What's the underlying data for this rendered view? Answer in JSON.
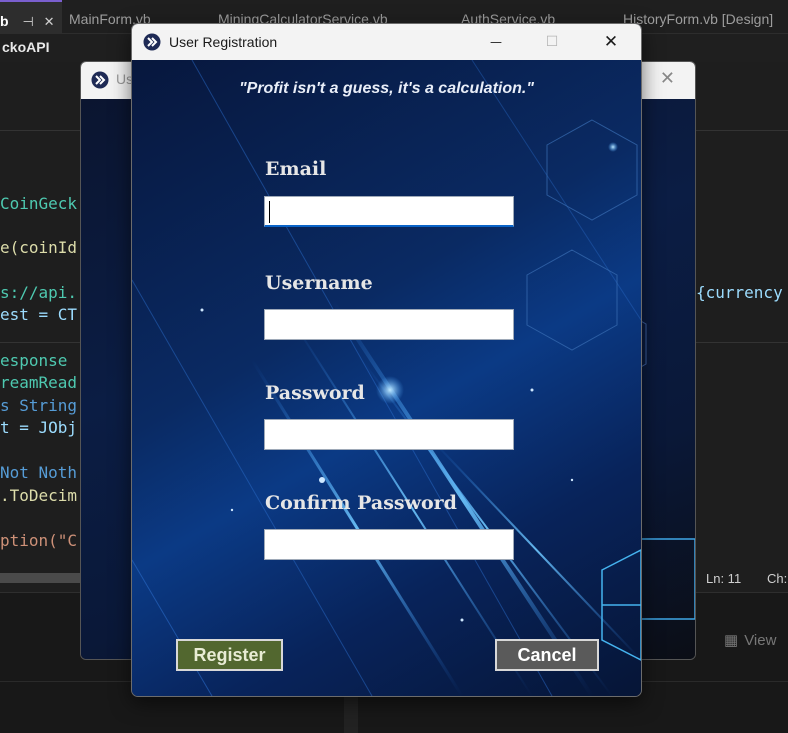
{
  "ide": {
    "tabs": [
      {
        "label": "b"
      },
      {
        "label": "MainForm.vb"
      },
      {
        "label": "MiningCalculatorService.vb"
      },
      {
        "label": "AuthService.vb"
      },
      {
        "label": "HistoryForm.vb [Design]"
      }
    ],
    "pin_icon": "⊣",
    "close_icon": "✕",
    "sub_label": "ckoAPI",
    "code_lines": [
      {
        "text": "CoinGeck",
        "color": "#4ec9b0"
      },
      {
        "text": "e(coinId",
        "color": "#dcdcaa"
      },
      {
        "text": "s://api.",
        "color": "#4ec9b0"
      },
      {
        "text": "est = CT",
        "color": "#9cdcfe"
      },
      {
        "text": "esponse",
        "color": "#4ec9b0"
      },
      {
        "text": "reamRead",
        "color": "#4ec9b0"
      },
      {
        "text": "s String",
        "color": "#569cd6"
      },
      {
        "text": "t = JObj",
        "color": "#9cdcfe"
      },
      {
        "text": "Not Noth",
        "color": "#569cd6"
      },
      {
        "text": ".ToDecim",
        "color": "#dcdcaa"
      },
      {
        "text": "ption(\"C",
        "color": "#ce9178"
      }
    ],
    "right_code": "{currency",
    "status_line": "Ln: 11",
    "status_col": "Ch:",
    "view_label": "View"
  },
  "bg_dialog": {
    "title": "Us"
  },
  "dialog": {
    "title": "User Registration",
    "minimize_icon": "—",
    "maximize_icon": "☐",
    "close_icon": "✕",
    "quote": "\"Profit isn't a guess, it's a calculation.\"",
    "fields": {
      "email": {
        "label": "Email",
        "value": ""
      },
      "username": {
        "label": "Username",
        "value": ""
      },
      "password": {
        "label": "Password",
        "value": ""
      },
      "confirm_password": {
        "label": "Confirm Password",
        "value": ""
      }
    },
    "register_label": "Register",
    "cancel_label": "Cancel"
  }
}
